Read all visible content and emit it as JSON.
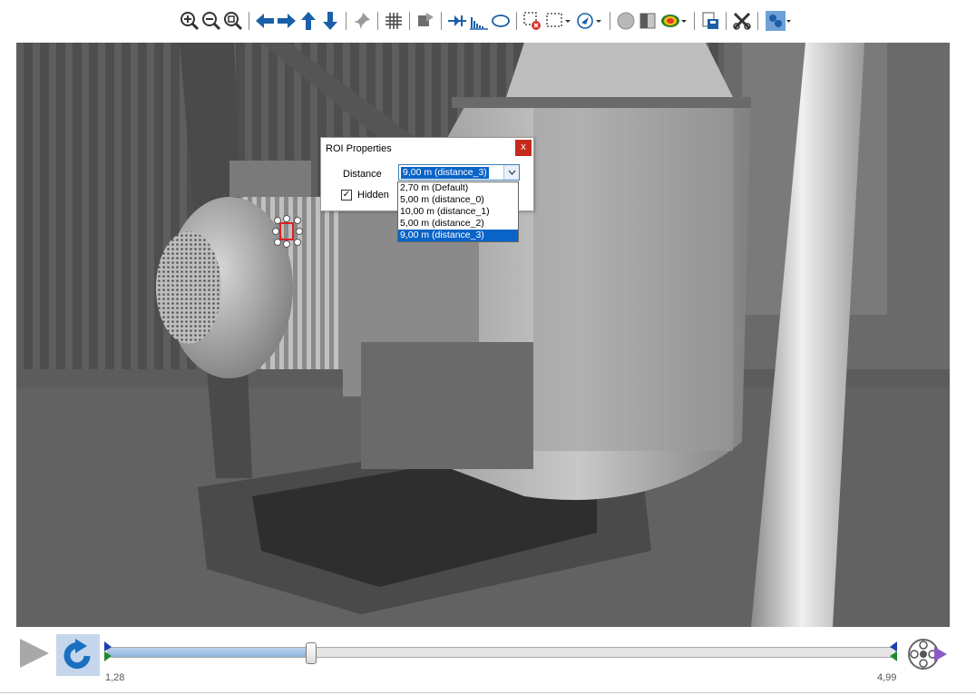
{
  "toolbar": {
    "buttons": [
      {
        "id": "zoom-in",
        "icon": "zoom-in-icon"
      },
      {
        "id": "zoom-out",
        "icon": "zoom-out-icon"
      },
      {
        "id": "zoom-fit",
        "icon": "zoom-fit-icon"
      },
      {
        "id": "pan-left",
        "icon": "arrow-left-icon"
      },
      {
        "id": "pan-right",
        "icon": "arrow-right-icon"
      },
      {
        "id": "pan-up",
        "icon": "arrow-up-icon"
      },
      {
        "id": "pan-down",
        "icon": "arrow-down-icon"
      },
      {
        "id": "pin",
        "icon": "pin-icon"
      },
      {
        "id": "grid",
        "icon": "grid-icon"
      },
      {
        "id": "rotate",
        "icon": "rotate-icon"
      },
      {
        "id": "profile",
        "icon": "profile-icon"
      },
      {
        "id": "histogram",
        "icon": "histogram-icon"
      },
      {
        "id": "ellipse",
        "icon": "ellipse-icon"
      },
      {
        "id": "delete-roi",
        "icon": "delete-roi-icon"
      },
      {
        "id": "rect-roi",
        "icon": "rectangle-select-icon"
      },
      {
        "id": "navigate",
        "icon": "navigate-icon"
      },
      {
        "id": "circle",
        "icon": "circle-icon"
      },
      {
        "id": "square",
        "icon": "square-icon"
      },
      {
        "id": "palette",
        "icon": "palette-icon"
      },
      {
        "id": "export",
        "icon": "export-icon"
      },
      {
        "id": "tools",
        "icon": "tools-icon"
      },
      {
        "id": "overlay",
        "icon": "overlay-icon"
      }
    ]
  },
  "dialog": {
    "title": "ROI Properties",
    "close_label": "x",
    "distance_label": "Distance",
    "distance_value": "9,00 m (distance_3)",
    "hidden_label": "Hidden",
    "hidden_checked": true,
    "check_mark": "✓",
    "options": [
      "2,70 m (Default)",
      "5,00 m (distance_0)",
      "10,00 m (distance_1)",
      "5,00 m (distance_2)",
      "9,00 m (distance_3)"
    ],
    "selected_index": 4
  },
  "player": {
    "range_start_label": "1,28",
    "range_end_label": "4,99",
    "position_fraction": 0.258
  },
  "colors": {
    "accent": "#0a64c8",
    "roi": "#e02020",
    "toolbar_icon": "#1a5fa8"
  }
}
